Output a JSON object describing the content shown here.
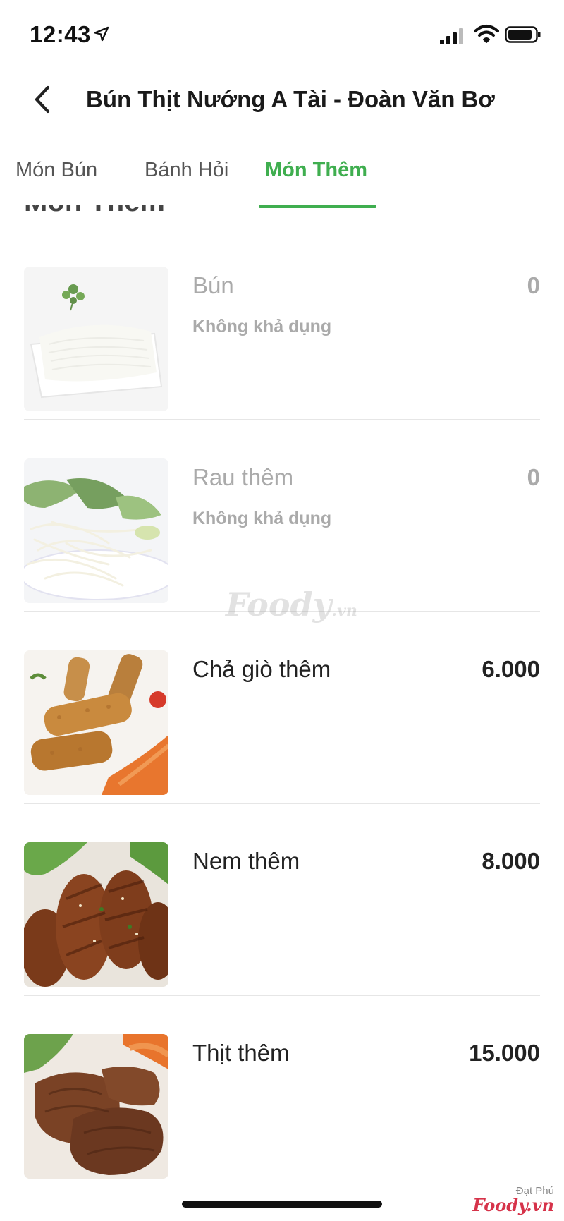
{
  "status_bar": {
    "time": "12:43",
    "icons": [
      "location-arrow-icon",
      "signal-icon",
      "wifi-icon",
      "battery-icon"
    ]
  },
  "header": {
    "title": "Bún Thịt Nướng A Tài - Đoàn Văn Bơ",
    "back_icon": "chevron-left-icon"
  },
  "tabs": [
    {
      "label": "Món Bún",
      "active": false
    },
    {
      "label": "Bánh Hỏi",
      "active": false
    },
    {
      "label": "Món Thêm",
      "active": true
    }
  ],
  "section": {
    "heading": "Món Thêm"
  },
  "items": [
    {
      "name": "Bún",
      "price": "0",
      "status": "Không khả dụng",
      "available": false
    },
    {
      "name": "Rau thêm",
      "price": "0",
      "status": "Không khả dụng",
      "available": false
    },
    {
      "name": "Chả giò thêm",
      "price": "6.000",
      "status": "",
      "available": true
    },
    {
      "name": "Nem thêm",
      "price": "8.000",
      "status": "",
      "available": true
    },
    {
      "name": "Thịt thêm",
      "price": "15.000",
      "status": "",
      "available": true
    }
  ],
  "watermark": {
    "center_brand": "Foody",
    "center_suffix": ".vn",
    "corner_location": "Đạt Phú",
    "corner_brand": "Foody.vn"
  },
  "colors": {
    "accent": "#3fae4f",
    "unavailable_text": "#aaaaaa",
    "divider": "#e6e6e6"
  }
}
